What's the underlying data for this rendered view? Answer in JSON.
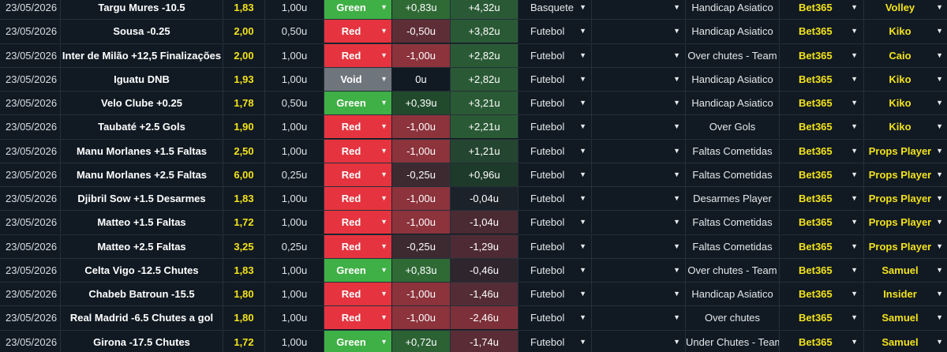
{
  "rows": [
    {
      "date": "23/05/2026",
      "event": "Targu Mures -10.5",
      "odds": "1,83",
      "stake": "1,00u",
      "result": "Green",
      "profit": "+0,83u",
      "profit_bg": "#2f6a35",
      "total": "+4,32u",
      "total_bg": "#2a5a35",
      "sport": "Basquete",
      "market": "Handicap Asiatico",
      "book": "Bet365",
      "tipster": "Volley"
    },
    {
      "date": "23/05/2026",
      "event": "Sousa -0.25",
      "odds": "2,00",
      "stake": "0,50u",
      "result": "Red",
      "profit": "-0,50u",
      "profit_bg": "#5e2e36",
      "total": "+3,82u",
      "total_bg": "#2a5a35",
      "sport": "Futebol",
      "market": "Handicap Asiatico",
      "book": "Bet365",
      "tipster": "Kiko"
    },
    {
      "date": "23/05/2026",
      "event": "Inter de Milão +12,5 Finalizações",
      "odds": "2,00",
      "stake": "1,00u",
      "result": "Red",
      "profit": "-1,00u",
      "profit_bg": "#8c333c",
      "total": "+2,82u",
      "total_bg": "#2a5a35",
      "sport": "Futebol",
      "market": "Over chutes - Team",
      "book": "Bet365",
      "tipster": "Caio"
    },
    {
      "date": "23/05/2026",
      "event": "Iguatu DNB",
      "odds": "1,93",
      "stake": "1,00u",
      "result": "Void",
      "profit": "0u",
      "profit_bg": "#111a23",
      "total": "+2,82u",
      "total_bg": "#2a5a35",
      "sport": "Futebol",
      "market": "Handicap Asiatico",
      "book": "Bet365",
      "tipster": "Kiko"
    },
    {
      "date": "23/05/2026",
      "event": "Velo Clube +0.25",
      "odds": "1,78",
      "stake": "0,50u",
      "result": "Green",
      "profit": "+0,39u",
      "profit_bg": "#214a2c",
      "total": "+3,21u",
      "total_bg": "#2a5a35",
      "sport": "Futebol",
      "market": "Handicap Asiatico",
      "book": "Bet365",
      "tipster": "Kiko"
    },
    {
      "date": "23/05/2026",
      "event": "Taubaté +2.5 Gols",
      "odds": "1,90",
      "stake": "1,00u",
      "result": "Red",
      "profit": "-1,00u",
      "profit_bg": "#8c333c",
      "total": "+2,21u",
      "total_bg": "#2a5a35",
      "sport": "Futebol",
      "market": "Over Gols",
      "book": "Bet365",
      "tipster": "Kiko"
    },
    {
      "date": "23/05/2026",
      "event": "Manu Morlanes +1.5 Faltas",
      "odds": "2,50",
      "stake": "1,00u",
      "result": "Red",
      "profit": "-1,00u",
      "profit_bg": "#8c333c",
      "total": "+1,21u",
      "total_bg": "#24452f",
      "sport": "Futebol",
      "market": "Faltas Cometidas",
      "book": "Bet365",
      "tipster": "Props Player"
    },
    {
      "date": "23/05/2026",
      "event": "Manu Morlanes +2.5 Faltas",
      "odds": "6,00",
      "stake": "0,25u",
      "result": "Red",
      "profit": "-0,25u",
      "profit_bg": "#3d2a31",
      "total": "+0,96u",
      "total_bg": "#1d3a2a",
      "sport": "Futebol",
      "market": "Faltas Cometidas",
      "book": "Bet365",
      "tipster": "Props Player"
    },
    {
      "date": "23/05/2026",
      "event": "Djibril Sow +1.5 Desarmes",
      "odds": "1,83",
      "stake": "1,00u",
      "result": "Red",
      "profit": "-1,00u",
      "profit_bg": "#8c333c",
      "total": "-0,04u",
      "total_bg": "#1c2229",
      "sport": "Futebol",
      "market": "Desarmes Player",
      "book": "Bet365",
      "tipster": "Props Player"
    },
    {
      "date": "23/05/2026",
      "event": "Matteo +1.5 Faltas",
      "odds": "1,72",
      "stake": "1,00u",
      "result": "Red",
      "profit": "-1,00u",
      "profit_bg": "#8c333c",
      "total": "-1,04u",
      "total_bg": "#4a2a33",
      "sport": "Futebol",
      "market": "Faltas Cometidas",
      "book": "Bet365",
      "tipster": "Props Player"
    },
    {
      "date": "23/05/2026",
      "event": "Matteo +2.5 Faltas",
      "odds": "3,25",
      "stake": "0,25u",
      "result": "Red",
      "profit": "-0,25u",
      "profit_bg": "#3d2a31",
      "total": "-1,29u",
      "total_bg": "#4e2b34",
      "sport": "Futebol",
      "market": "Faltas Cometidas",
      "book": "Bet365",
      "tipster": "Props Player"
    },
    {
      "date": "23/05/2026",
      "event": "Celta Vigo -12.5 Chutes",
      "odds": "1,83",
      "stake": "1,00u",
      "result": "Green",
      "profit": "+0,83u",
      "profit_bg": "#2f6a35",
      "total": "-0,46u",
      "total_bg": "#2e252d",
      "sport": "Futebol",
      "market": "Over chutes - Team",
      "book": "Bet365",
      "tipster": "Samuel"
    },
    {
      "date": "23/05/2026",
      "event": "Chabeb Batroun -15.5",
      "odds": "1,80",
      "stake": "1,00u",
      "result": "Red",
      "profit": "-1,00u",
      "profit_bg": "#8c333c",
      "total": "-1,46u",
      "total_bg": "#532c35",
      "sport": "Futebol",
      "market": "Handicap Asiatico",
      "book": "Bet365",
      "tipster": "Insider"
    },
    {
      "date": "23/05/2026",
      "event": "Real Madrid -6.5 Chutes a gol",
      "odds": "1,80",
      "stake": "1,00u",
      "result": "Red",
      "profit": "-1,00u",
      "profit_bg": "#8c333c",
      "total": "-2,46u",
      "total_bg": "#7d3039",
      "sport": "Futebol",
      "market": "Over chutes",
      "book": "Bet365",
      "tipster": "Samuel"
    },
    {
      "date": "23/05/2026",
      "event": "Girona -17.5 Chutes",
      "odds": "1,72",
      "stake": "1,00u",
      "result": "Green",
      "profit": "+0,72u",
      "profit_bg": "#2b6133",
      "total": "-1,74u",
      "total_bg": "#5a2d36",
      "sport": "Futebol",
      "market": "Under Chutes - Team",
      "book": "Bet365",
      "tipster": "Samuel"
    }
  ],
  "icons": {
    "dropdown": "chevron-down-icon"
  }
}
